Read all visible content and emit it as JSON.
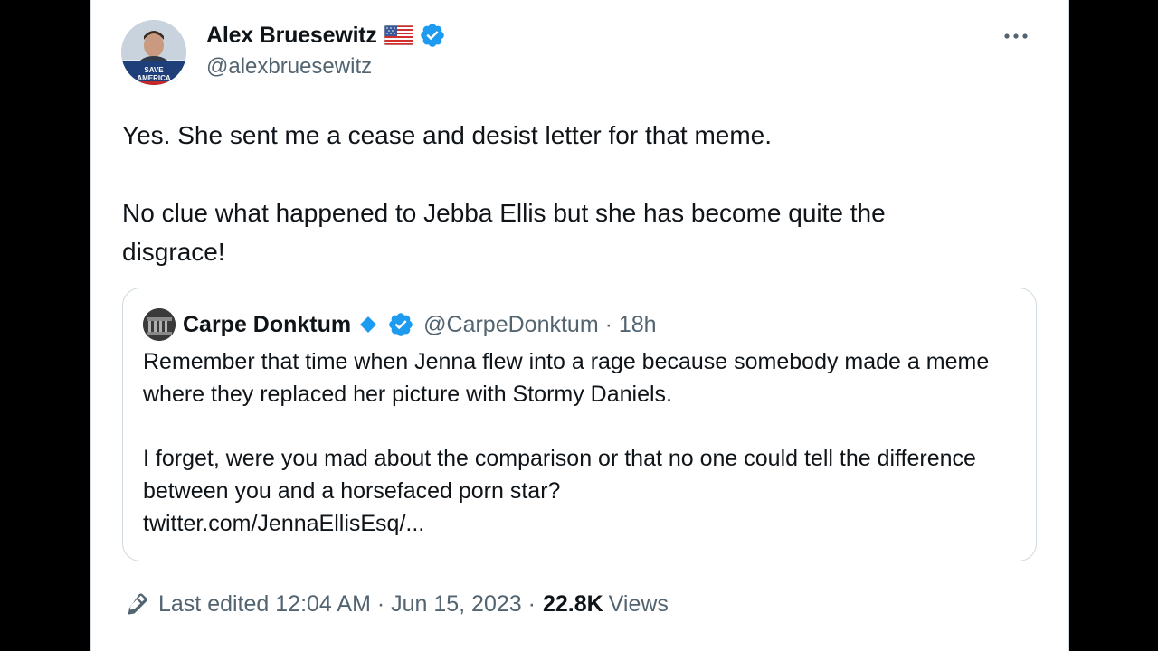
{
  "author": {
    "name": "Alex Bruesewitz",
    "handle": "@alexbruesewitz",
    "avatar_text": "SAVE AMERICA"
  },
  "icons": {
    "flag": "us-flag-icon",
    "verified": "verified-badge-icon",
    "more": "more-options-icon",
    "diamond": "blue-diamond-icon",
    "edit": "pencil-icon"
  },
  "tweet": {
    "text_line1": "Yes. She sent me a cease and desist letter for that meme.",
    "text_line2": "No clue what happened to Jebba Ellis but she has become quite the disgrace!"
  },
  "quote": {
    "name": "Carpe Donktum",
    "handle_time": "@CarpeDonktum · 18h",
    "para1": "Remember that time when Jenna flew into a rage because somebody made a meme where they replaced her picture with Stormy Daniels.",
    "para2": "I forget, were you mad about the comparison or that no one could tell the difference between you and a horsefaced porn star?",
    "link": "twitter.com/JennaEllisEsq/..."
  },
  "meta": {
    "edited": "Last edited 12:04 AM · Jun 15, 2023 ·",
    "views_count": "22.8K",
    "views_label": "Views"
  },
  "colors": {
    "accent": "#1d9bf0",
    "text": "#0f1419",
    "secondary": "#536471",
    "border": "#cfd9de"
  }
}
